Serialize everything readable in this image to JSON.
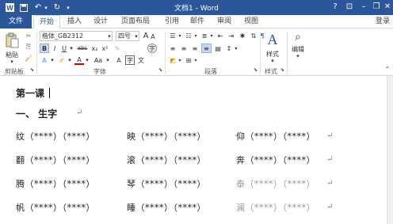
{
  "window": {
    "title": "文档1 - Word",
    "quick_access": [
      "save-icon",
      "undo-icon",
      "redo-icon"
    ],
    "controls": [
      "help",
      "ribbon-display",
      "minimize",
      "restore",
      "close"
    ]
  },
  "tabs": [
    "文件",
    "开始",
    "插入",
    "设计",
    "页面布局",
    "引用",
    "邮件",
    "审阅",
    "视图"
  ],
  "login_label": "登录",
  "ribbon": {
    "clipboard": {
      "paste_label": "粘贴",
      "group_label": "剪贴板"
    },
    "font": {
      "font_name": "楷体_GB2312",
      "font_size": "四号",
      "grow_icon": "A",
      "shrink_icon": "A",
      "group_label": "字体",
      "format_buttons": [
        "B",
        "I",
        "U",
        "abc",
        "x₂",
        "x²"
      ],
      "color_buttons": [
        "A",
        "Aa",
        "A",
        "A"
      ]
    },
    "paragraph": {
      "group_label": "段落"
    },
    "styles": {
      "label": "样式",
      "group_label": "样式"
    },
    "editing": {
      "label": "编辑"
    }
  },
  "document": {
    "lesson_title": "第一课",
    "section_title": "一、 生字",
    "rows": [
      [
        "纹（****）（****）",
        "映（****）（****）",
        "仰（****）（****）"
      ],
      [
        "翻（****）（****）",
        "滚（****）（****）",
        "奔（****）（****）"
      ],
      [
        "腾（****）（****）",
        "琴（****）（****）",
        "泰（****）（****）"
      ],
      [
        "帆（****）（****）",
        "睡（****）（****）",
        "澜（****）（****）"
      ]
    ],
    "paragraph_mark": "↵"
  },
  "colors": {
    "accent": "#2b579a",
    "ribbon_bg": "#ffffff",
    "highlight": "#c5d9f1"
  }
}
